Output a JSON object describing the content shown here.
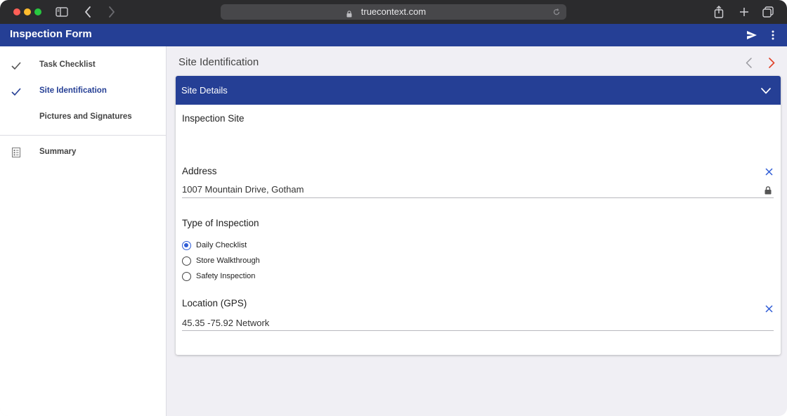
{
  "browser": {
    "url": "truecontext.com"
  },
  "app": {
    "title": "Inspection Form"
  },
  "nav": {
    "items": [
      {
        "label": "Task Checklist",
        "state": "done"
      },
      {
        "label": "Site Identification",
        "state": "active"
      },
      {
        "label": "Pictures and Signatures",
        "state": "none"
      }
    ],
    "summary_label": "Summary"
  },
  "page": {
    "title": "Site Identification"
  },
  "section": {
    "title": "Site Details",
    "inspection_site_label": "Inspection Site",
    "address": {
      "label": "Address",
      "value": "1007 Mountain Drive, Gotham"
    },
    "inspection_type": {
      "label": "Type of Inspection",
      "options": [
        {
          "label": "Daily Checklist",
          "selected": true
        },
        {
          "label": "Store Walkthrough",
          "selected": false
        },
        {
          "label": "Safety Inspection",
          "selected": false
        }
      ]
    },
    "gps": {
      "label": "Location (GPS)",
      "value": "45.35 -75.92 Network"
    }
  },
  "colors": {
    "brand": "#253f95",
    "radio_accent": "#2f5cd6",
    "next_arrow": "#e0452b"
  }
}
